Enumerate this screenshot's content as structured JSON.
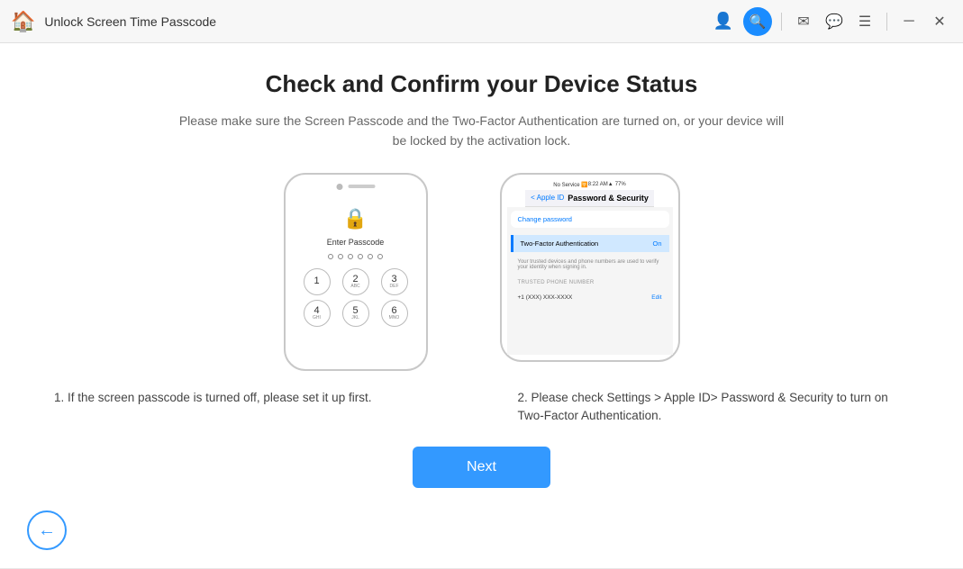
{
  "titlebar": {
    "title": "Unlock Screen Time Passcode",
    "icons": {
      "user": "👤",
      "search": "🔍",
      "mail": "✉",
      "chat": "💬",
      "menu": "☰",
      "minimize": "─",
      "close": "✕"
    }
  },
  "main": {
    "title": "Check and Confirm your Device Status",
    "subtitle": "Please make sure the Screen Passcode and the Two-Factor Authentication are turned on, or your device will be locked by the activation lock.",
    "phone1": {
      "enter_passcode": "Enter Passcode",
      "keys": [
        {
          "num": "1",
          "letters": ""
        },
        {
          "num": "2",
          "letters": "ABC"
        },
        {
          "num": "3",
          "letters": "DEF"
        },
        {
          "num": "4",
          "letters": "GHI"
        },
        {
          "num": "5",
          "letters": "JKL"
        },
        {
          "num": "6",
          "letters": "MNO"
        }
      ]
    },
    "phone2": {
      "status_left": "No Service 🛜",
      "status_center": "8:22 AM",
      "status_right": "77%",
      "nav_back": "< Apple ID",
      "nav_title": "Password & Security",
      "change_password": "Change password",
      "two_factor_label": "Two-Factor Authentication",
      "two_factor_status": "On",
      "info_text": "Your trusted devices and phone numbers are used to verify your identity when signing in.",
      "trusted_label": "TRUSTED PHONE NUMBER",
      "trusted_row_left": "+1 (XXX) XXX-XXXX",
      "trusted_edit": "Edit"
    },
    "desc1": "1. If the screen passcode is turned off, please set it up first.",
    "desc2": "2. Please check Settings > Apple ID> Password & Security to turn on Two-Factor Authentication.",
    "next_label": "Next"
  },
  "back_label": "←"
}
